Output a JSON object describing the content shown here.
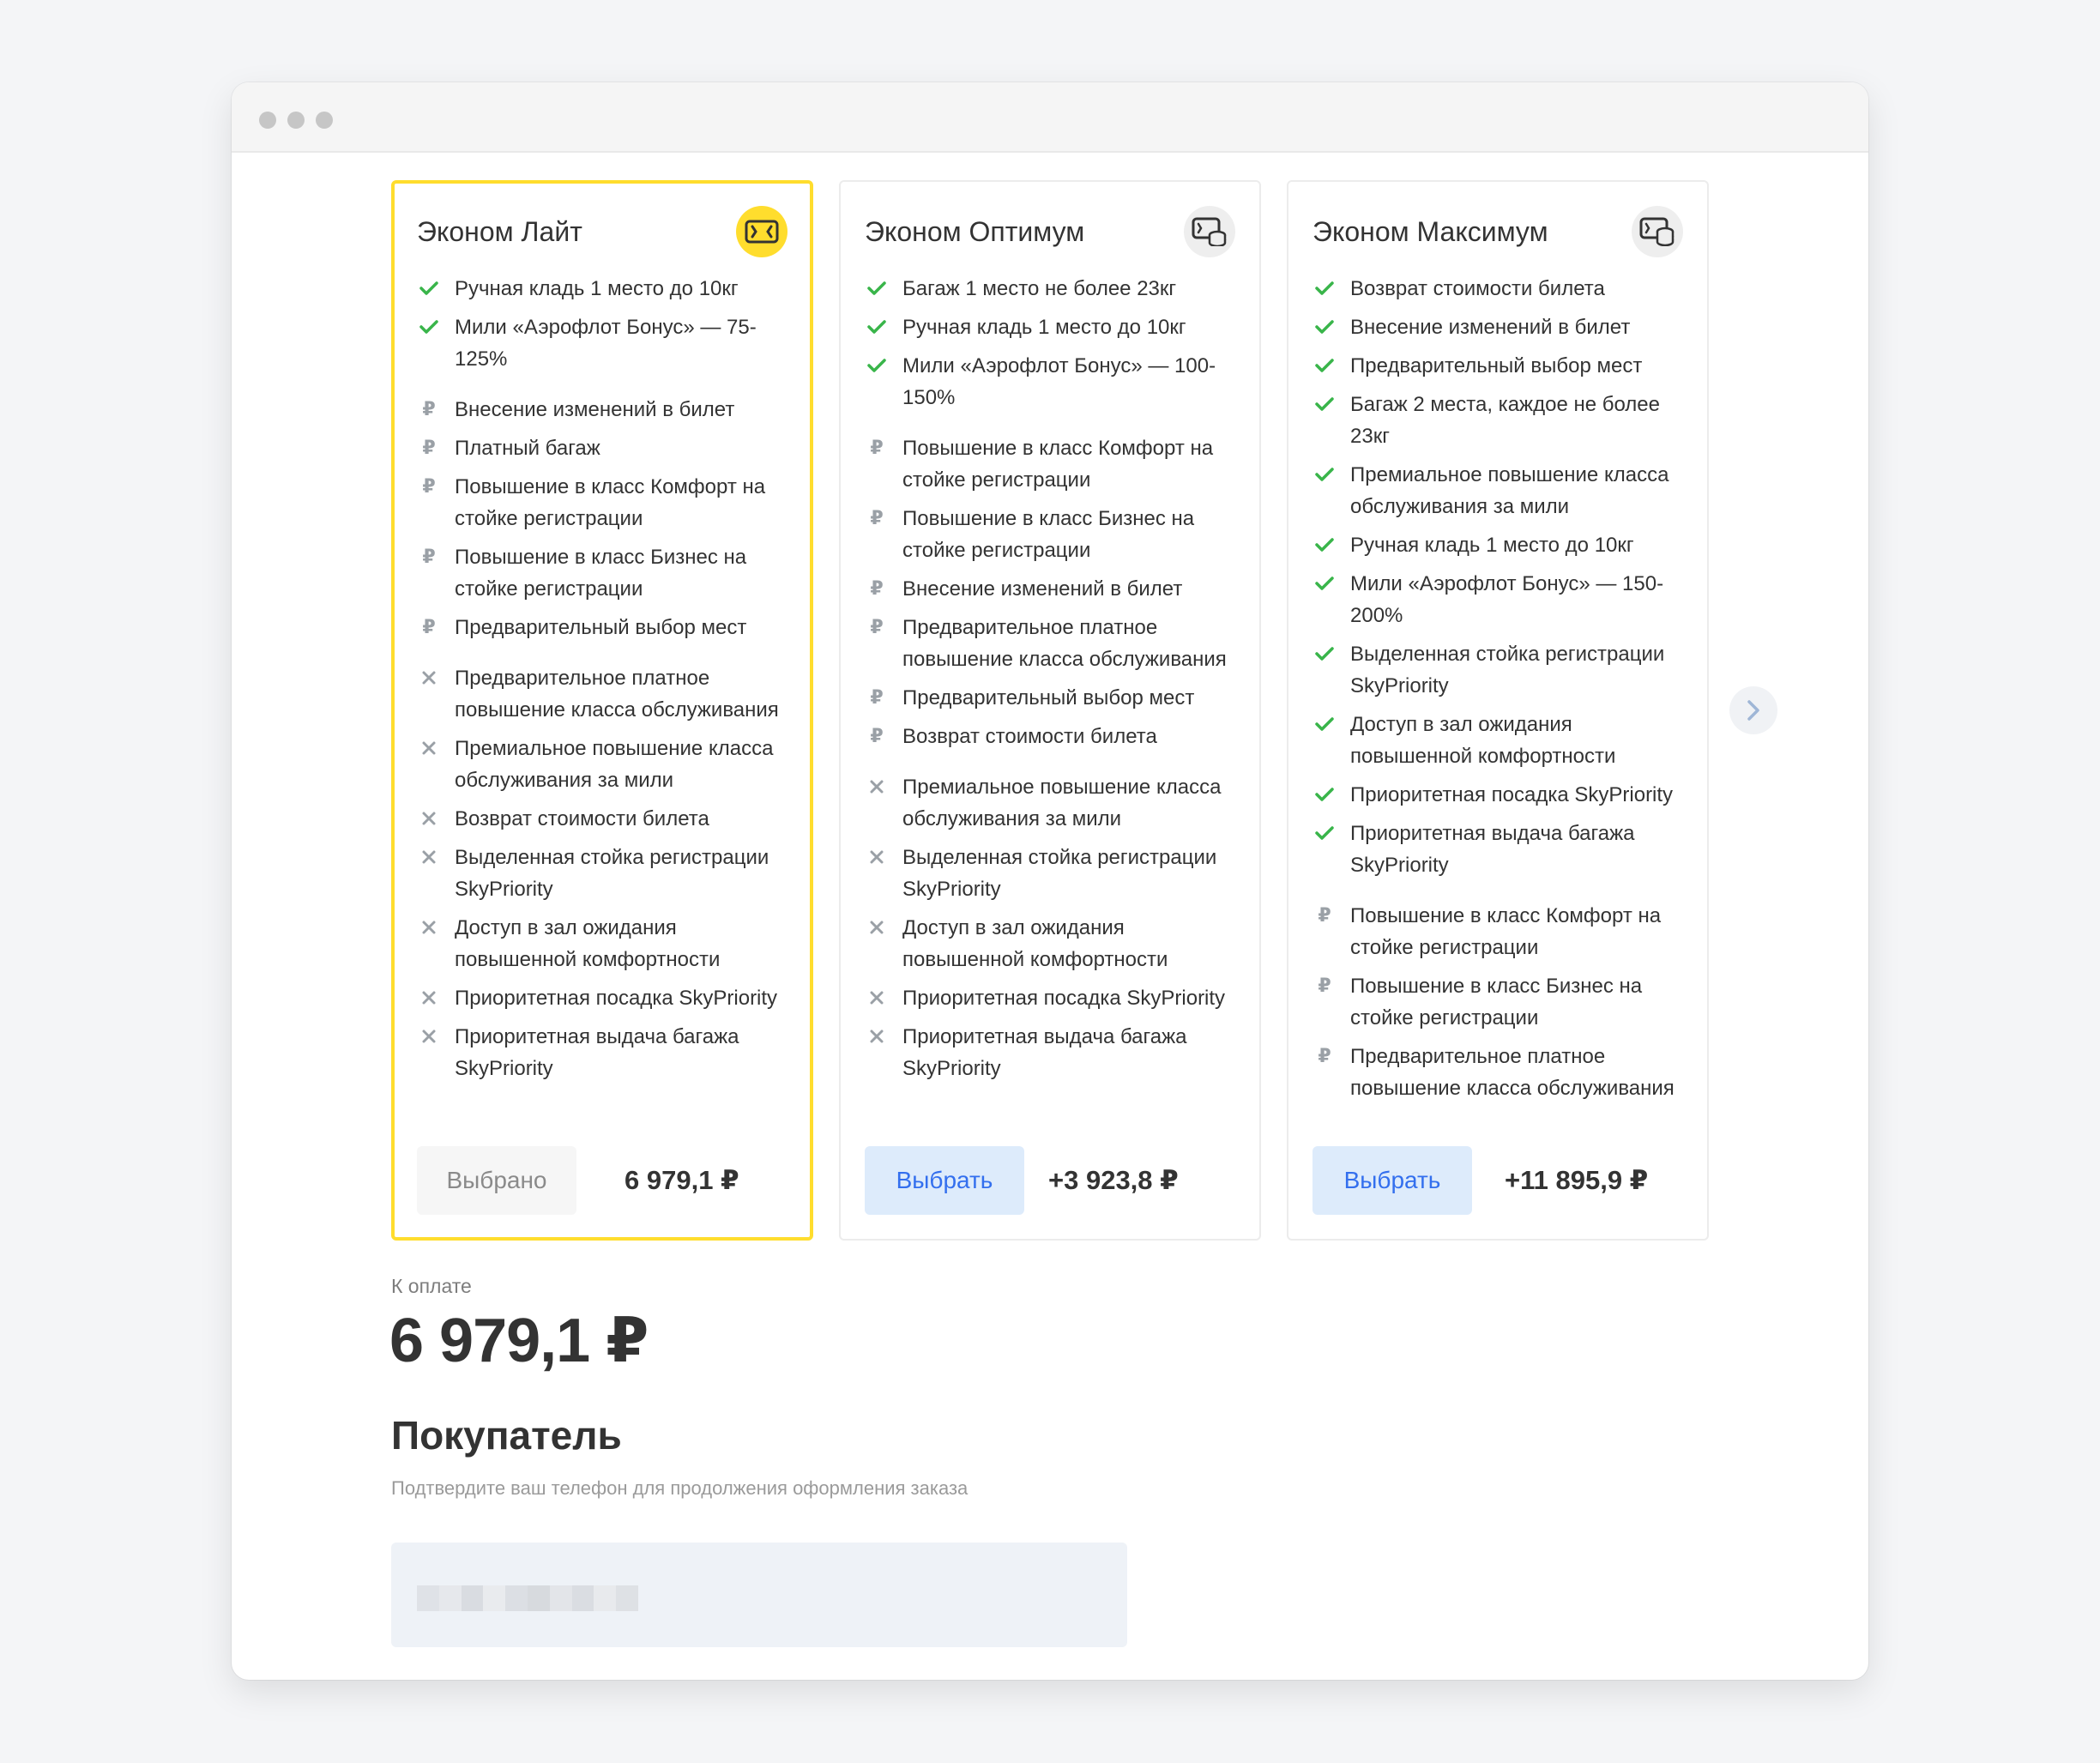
{
  "tariffs": [
    {
      "name": "Эконом Лайт",
      "selected": true,
      "button_label": "Выбрано",
      "price": "6 979,1 ₽",
      "features": [
        {
          "type": "included",
          "text": "Ручная кладь 1 место до 10кг"
        },
        {
          "type": "included",
          "text": "Мили «Аэрофлот Бонус» — 75-125%"
        },
        {
          "type": "paid",
          "text": "Внесение изменений в билет",
          "gap": true
        },
        {
          "type": "paid",
          "text": "Платный багаж"
        },
        {
          "type": "paid",
          "text": "Повышение в класс Комфорт на стойке регистрации"
        },
        {
          "type": "paid",
          "text": "Повышение в класс Бизнес на стойке регистрации"
        },
        {
          "type": "paid",
          "text": "Предварительный выбор мест"
        },
        {
          "type": "unavailable",
          "text": "Предварительное платное повышение класса обслуживания",
          "gap": true
        },
        {
          "type": "unavailable",
          "text": "Премиальное повышение класса обслуживания за мили"
        },
        {
          "type": "unavailable",
          "text": "Возврат стоимости билета"
        },
        {
          "type": "unavailable",
          "text": "Выделенная стойка регистрации SkyPriority"
        },
        {
          "type": "unavailable",
          "text": "Доступ в зал ожидания повышенной комфортности"
        },
        {
          "type": "unavailable",
          "text": "Приоритетная посадка SkyPriority"
        },
        {
          "type": "unavailable",
          "text": "Приоритетная выдача багажа SkyPriority"
        }
      ]
    },
    {
      "name": "Эконом Оптимум",
      "selected": false,
      "button_label": "Выбрать",
      "price": "+3 923,8 ₽",
      "features": [
        {
          "type": "included",
          "text": "Багаж 1 место не более 23кг"
        },
        {
          "type": "included",
          "text": "Ручная кладь 1 место до 10кг"
        },
        {
          "type": "included",
          "text": "Мили «Аэрофлот Бонус» — 100-150%"
        },
        {
          "type": "paid",
          "text": "Повышение в класс Комфорт на стойке регистрации",
          "gap": true
        },
        {
          "type": "paid",
          "text": "Повышение в класс Бизнес на стойке регистрации"
        },
        {
          "type": "paid",
          "text": "Внесение изменений в билет"
        },
        {
          "type": "paid",
          "text": "Предварительное платное повышение класса обслуживания"
        },
        {
          "type": "paid",
          "text": "Предварительный выбор мест"
        },
        {
          "type": "paid",
          "text": "Возврат стоимости билета"
        },
        {
          "type": "unavailable",
          "text": "Премиальное повышение класса обслуживания за мили",
          "gap": true
        },
        {
          "type": "unavailable",
          "text": "Выделенная стойка регистрации SkyPriority"
        },
        {
          "type": "unavailable",
          "text": "Доступ в зал ожидания повышенной комфортности"
        },
        {
          "type": "unavailable",
          "text": "Приоритетная посадка SkyPriority"
        },
        {
          "type": "unavailable",
          "text": "Приоритетная выдача багажа SkyPriority"
        }
      ]
    },
    {
      "name": "Эконом Максимум",
      "selected": false,
      "button_label": "Выбрать",
      "price": "+11 895,9 ₽",
      "features": [
        {
          "type": "included",
          "text": "Возврат стоимости билета"
        },
        {
          "type": "included",
          "text": "Внесение изменений в билет"
        },
        {
          "type": "included",
          "text": "Предварительный выбор мест"
        },
        {
          "type": "included",
          "text": "Багаж 2 места, каждое не более 23кг"
        },
        {
          "type": "included",
          "text": "Премиальное повышение класса обслуживания за мили"
        },
        {
          "type": "included",
          "text": "Ручная кладь 1 место до 10кг"
        },
        {
          "type": "included",
          "text": "Мили «Аэрофлот Бонус» — 150-200%"
        },
        {
          "type": "included",
          "text": "Выделенная стойка регистрации SkyPriority"
        },
        {
          "type": "included",
          "text": "Доступ в зал ожидания повышенной комфортности"
        },
        {
          "type": "included",
          "text": "Приоритетная посадка SkyPriority"
        },
        {
          "type": "included",
          "text": "Приоритетная выдача багажа SkyPriority"
        },
        {
          "type": "paid",
          "text": "Повышение в класс Комфорт на стойке регистрации",
          "gap": true
        },
        {
          "type": "paid",
          "text": "Повышение в класс Бизнес на стойке регистрации"
        },
        {
          "type": "paid",
          "text": "Предварительное платное повышение класса обслуживания"
        }
      ]
    }
  ],
  "icons": {
    "included": "check-icon",
    "paid": "ruble-icon",
    "unavailable": "cross-icon",
    "next": "chevron-right-icon"
  },
  "colors": {
    "accent_yellow": "#ffdd2d",
    "check_green": "#39b54a",
    "link_blue": "#336fee",
    "button_blue_bg": "#ddebfb"
  },
  "payment": {
    "label": "К оплате",
    "total": "6 979,1 ₽"
  },
  "buyer": {
    "title": "Покупатель",
    "hint": "Подтвердите ваш телефон для продолжения оформления заказа"
  }
}
